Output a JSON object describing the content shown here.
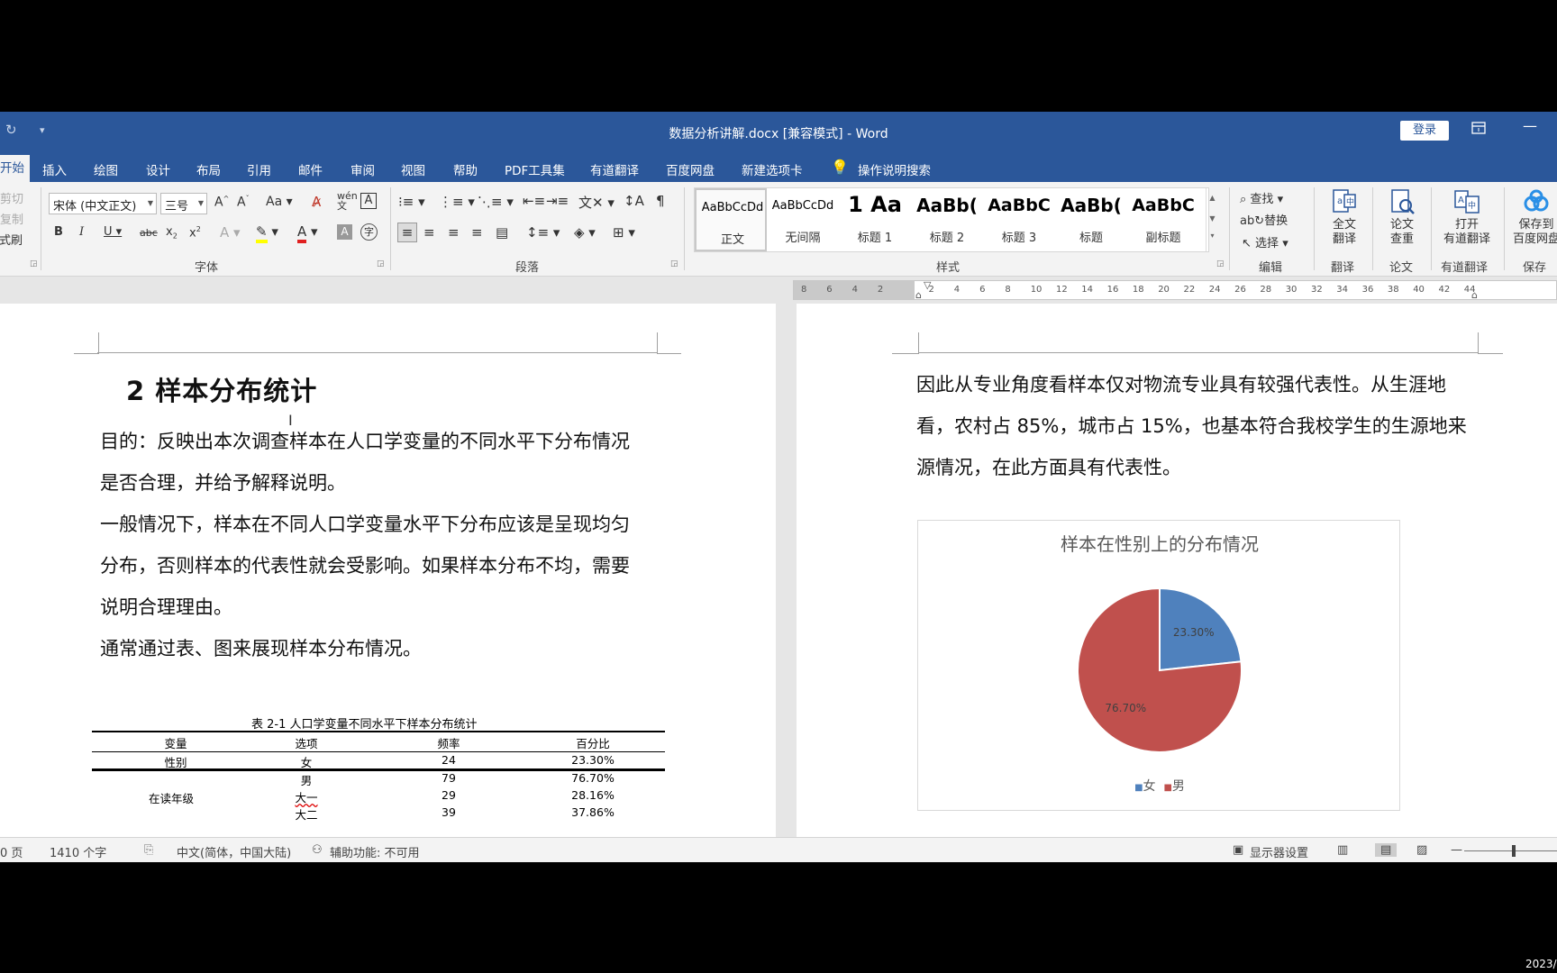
{
  "window": {
    "title": "数据分析讲解.docx [兼容模式]  -  Word",
    "login": "登录"
  },
  "tabs": [
    {
      "label": "开始",
      "active": true
    },
    {
      "label": "插入"
    },
    {
      "label": "绘图"
    },
    {
      "label": "设计"
    },
    {
      "label": "布局"
    },
    {
      "label": "引用"
    },
    {
      "label": "邮件"
    },
    {
      "label": "审阅"
    },
    {
      "label": "视图"
    },
    {
      "label": "帮助"
    },
    {
      "label": "PDF工具集"
    },
    {
      "label": "有道翻译"
    },
    {
      "label": "百度网盘"
    },
    {
      "label": "新建选项卡"
    }
  ],
  "tell_me": "操作说明搜索",
  "ribbon": {
    "clipboard": {
      "cut": "剪切",
      "copy": "复制",
      "format_painter": "格式刷"
    },
    "font": {
      "name": "宋体 (中文正文)",
      "size": "三号",
      "label": "字体"
    },
    "paragraph": {
      "label": "段落"
    },
    "styles": {
      "label": "样式",
      "items": [
        {
          "sample": "AaBbCcDd",
          "name": "正文",
          "selected": true
        },
        {
          "sample": "AaBbCcDd",
          "name": "无间隔"
        },
        {
          "sample": "1  Aa",
          "name": "标题 1"
        },
        {
          "sample": "AaBb(",
          "name": "标题 2"
        },
        {
          "sample": "AaBbC",
          "name": "标题 3"
        },
        {
          "sample": "AaBb(",
          "name": "标题"
        },
        {
          "sample": "AaBbC",
          "name": "副标题"
        }
      ]
    },
    "editing": {
      "find": "查找",
      "replace": "替换",
      "select": "选择",
      "label": "编辑"
    },
    "translate": {
      "full": "全文\n翻译",
      "label": "翻译"
    },
    "paper": {
      "check": "论文\n查重",
      "label": "论文"
    },
    "youdao": {
      "open": "打开\n有道翻译",
      "label": "有道翻译"
    },
    "save": {
      "to_baidu": "保存到\n百度网盘",
      "label": "保存"
    }
  },
  "ruler": {
    "numbers": [
      "8",
      "6",
      "4",
      "2",
      "",
      "2",
      "4",
      "6",
      "8",
      "10",
      "12",
      "14",
      "16",
      "18",
      "20",
      "22",
      "24",
      "26",
      "28",
      "30",
      "32",
      "34",
      "36",
      "38",
      "40",
      "42",
      "44"
    ]
  },
  "page_left": {
    "heading": "2  样本分布统计",
    "paragraphs": [
      "目的：反映出本次调查样本在人口学变量的不同水平下分布情况是否合理，并给予解释说明。",
      "一般情况下，样本在不同人口学变量水平下分布应该是呈现均匀分布，否则样本的代表性就会受影响。如果样本分布不均，需要说明合理理由。",
      "通常通过表、图来展现样本分布情况。"
    ],
    "table": {
      "caption": "表 2-1 人口学变量不同水平下样本分布统计",
      "headers": [
        "变量",
        "选项",
        "频率",
        "百分比"
      ],
      "rows": [
        [
          "性别",
          "女",
          "24",
          "23.30%"
        ],
        [
          "",
          "男",
          "79",
          "76.70%"
        ],
        [
          "在读年级",
          "大一",
          "29",
          "28.16%"
        ],
        [
          "",
          "大二",
          "39",
          "37.86%"
        ]
      ]
    }
  },
  "page_right": {
    "paragraph": "因此从专业角度看样本仅对物流专业具有较强代表性。从生涯地看，农村占 85%，城市占 15%，也基本符合我校学生的生源地来源情况，在此方面具有代表性。"
  },
  "chart_data": {
    "type": "pie",
    "title": "样本在性别上的分布情况",
    "categories": [
      "女",
      "男"
    ],
    "values": [
      23.3,
      76.7
    ],
    "data_labels": [
      "23.30%",
      "76.70%"
    ],
    "colors": [
      "#4f81bd",
      "#c0504d"
    ],
    "legend": "bottom"
  },
  "status": {
    "page": "0 页",
    "words": "1410 个字",
    "language": "中文(简体，中国大陆)",
    "accessibility": "辅助功能: 不可用",
    "display_settings": "显示器设置",
    "zoom_minus": "—"
  },
  "date_stamp": "2023/"
}
